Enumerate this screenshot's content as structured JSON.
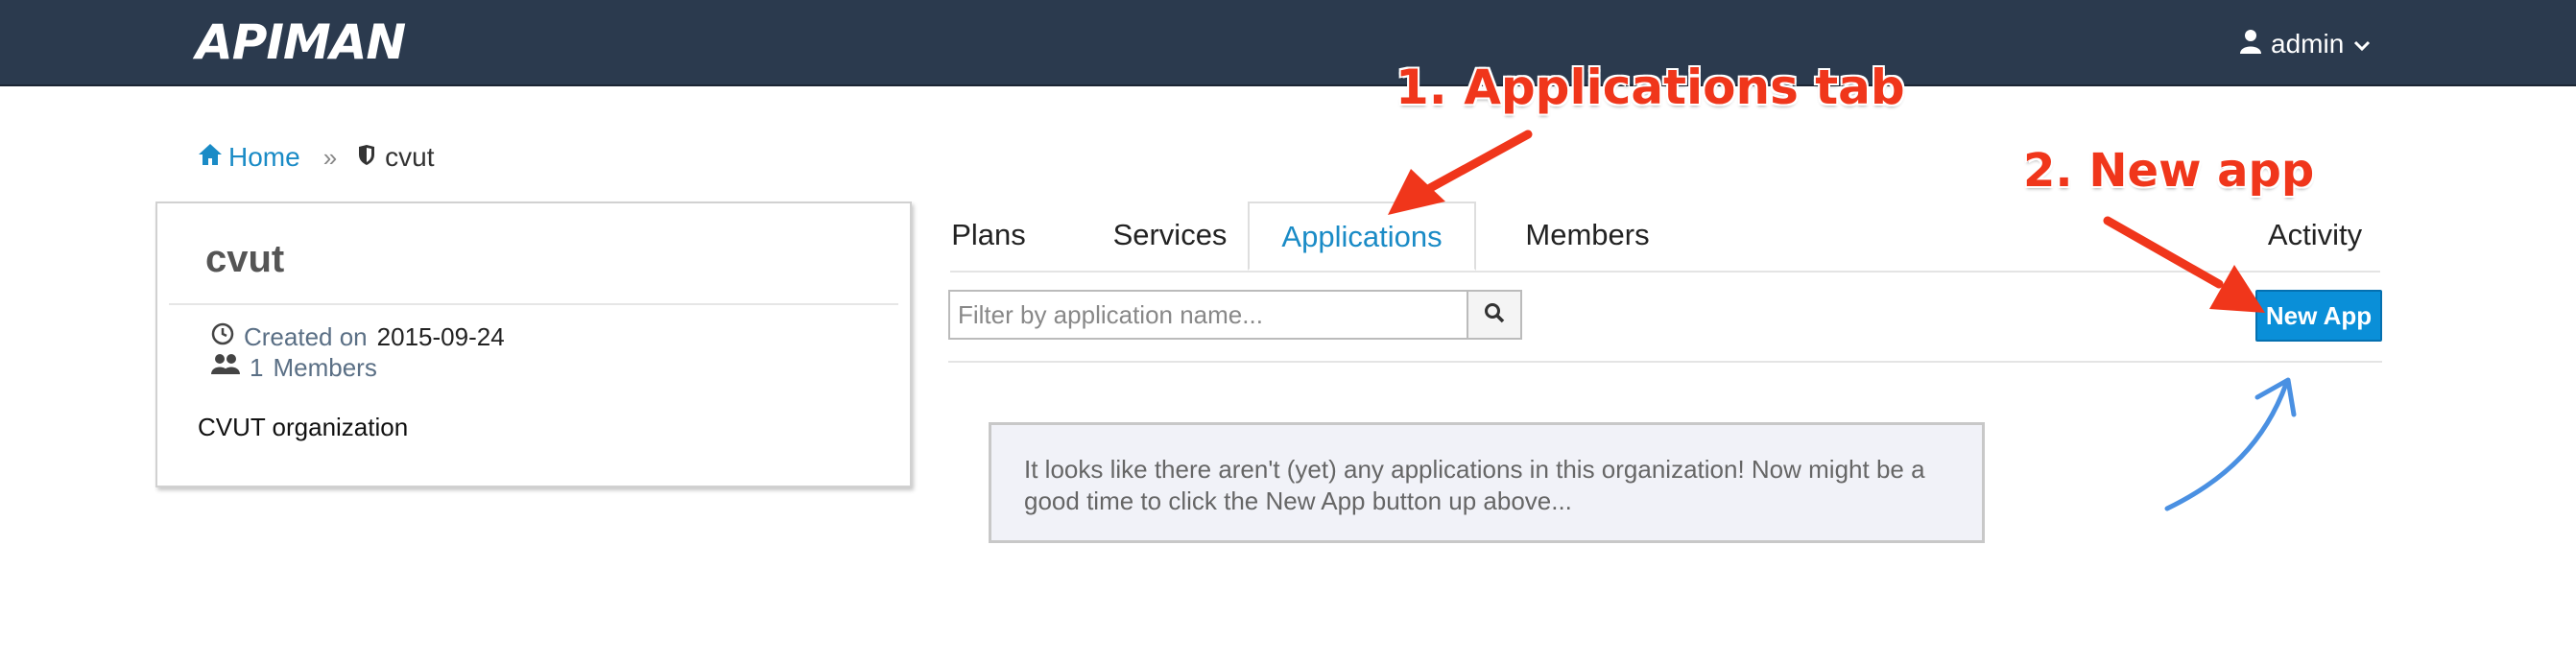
{
  "header": {
    "logo_text": "APIMAN",
    "user": {
      "name": "admin",
      "icon": "user-icon",
      "caret_icon": "chevron-down-icon"
    },
    "background_color": "#2b3a4e"
  },
  "breadcrumb": {
    "home_label": "Home",
    "separator": "»",
    "current_label": "cvut",
    "home_icon": "home-icon",
    "current_icon": "shield-icon"
  },
  "org": {
    "name": "cvut",
    "created_label": "Created on",
    "created_date": "2015-09-24",
    "members_count": "1",
    "members_label": "Members",
    "description": "CVUT organization"
  },
  "tabs": [
    {
      "label": "Plans",
      "active": false
    },
    {
      "label": "Services",
      "active": false
    },
    {
      "label": "Applications",
      "active": true
    },
    {
      "label": "Members",
      "active": false
    },
    {
      "label": "Activity",
      "active": false
    }
  ],
  "filter": {
    "placeholder": "Filter by application name...",
    "value": "",
    "search_icon": "search-icon"
  },
  "new_app_label": "New App",
  "empty_message": "It looks like there aren't (yet) any applications in this organization! Now might be a good time to click the New App button up above...",
  "annotations": {
    "step1": "1. Applications tab",
    "step2": "2. New app",
    "color": "#f0361b",
    "hint_arrow_color": "#4a90e2"
  },
  "colors": {
    "accent": "#1a8bc6",
    "button": "#0a8fd8"
  }
}
